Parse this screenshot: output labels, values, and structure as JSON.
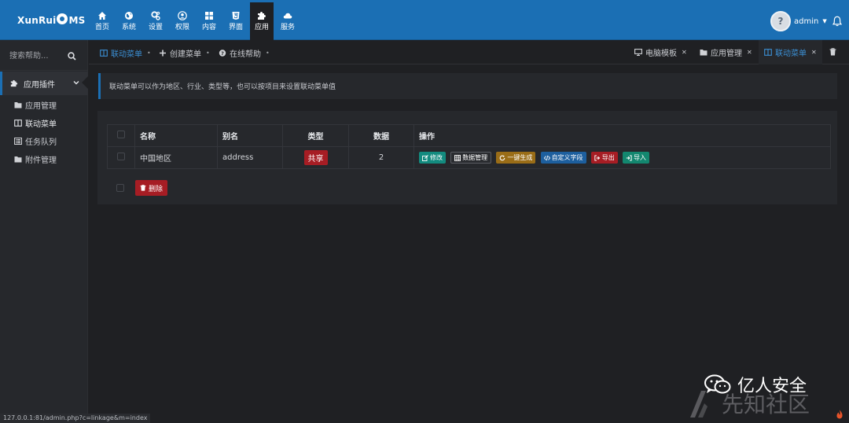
{
  "brand": {
    "logo_text_left": "XunRui",
    "logo_text_right": "MS"
  },
  "nav": [
    {
      "label": "首页",
      "icon": "home-icon"
    },
    {
      "label": "系统",
      "icon": "globe-icon"
    },
    {
      "label": "设置",
      "icon": "gears-icon"
    },
    {
      "label": "权限",
      "icon": "user-circle-icon"
    },
    {
      "label": "内容",
      "icon": "grid-icon"
    },
    {
      "label": "界面",
      "icon": "html5-icon"
    },
    {
      "label": "应用",
      "icon": "puzzle-icon",
      "active": true
    },
    {
      "label": "服务",
      "icon": "cloud-icon"
    }
  ],
  "user": {
    "name": "admin",
    "avatar_text": "?"
  },
  "sidebar": {
    "search_placeholder": "搜索帮助...",
    "group": {
      "label": "应用插件"
    },
    "items": [
      {
        "label": "应用管理",
        "icon": "folder-icon"
      },
      {
        "label": "联动菜单",
        "icon": "columns-icon"
      },
      {
        "label": "任务队列",
        "icon": "list-icon"
      },
      {
        "label": "附件管理",
        "icon": "folder-icon"
      }
    ]
  },
  "page_tabs": [
    {
      "label": "联动菜单",
      "active": true
    },
    {
      "label": "创建菜单"
    },
    {
      "label": "在线帮助"
    }
  ],
  "window_tabs": [
    {
      "label": "电脑模板"
    },
    {
      "label": "应用管理"
    },
    {
      "label": "联动菜单",
      "active": true
    }
  ],
  "notice": "联动菜单可以作为地区、行业、类型等，也可以按项目来设置联动菜单值",
  "table": {
    "headers": [
      "名称",
      "别名",
      "类型",
      "数据",
      "操作"
    ],
    "rows": [
      {
        "name": "中国地区",
        "alias": "address",
        "type": "共享",
        "count": "2",
        "actions": [
          {
            "label": "修改",
            "color": "#138b7f"
          },
          {
            "label": "数据管理",
            "color": "#2a2c30"
          },
          {
            "label": "一键生成",
            "color": "#9a6d17"
          },
          {
            "label": "自定义字段",
            "color": "#1d5f9e"
          },
          {
            "label": "导出",
            "color": "#a61d24"
          },
          {
            "label": "导入",
            "color": "#13876f"
          }
        ]
      }
    ],
    "delete_label": "删除"
  },
  "status_url": "127.0.0.1:81/admin.php?c=linkage&m=index",
  "watermark": {
    "line1": "亿人安全",
    "line2": "先知社区"
  },
  "colors": {
    "primary": "#1b6fb4",
    "danger": "#a61d24",
    "background": "#1f2023"
  }
}
